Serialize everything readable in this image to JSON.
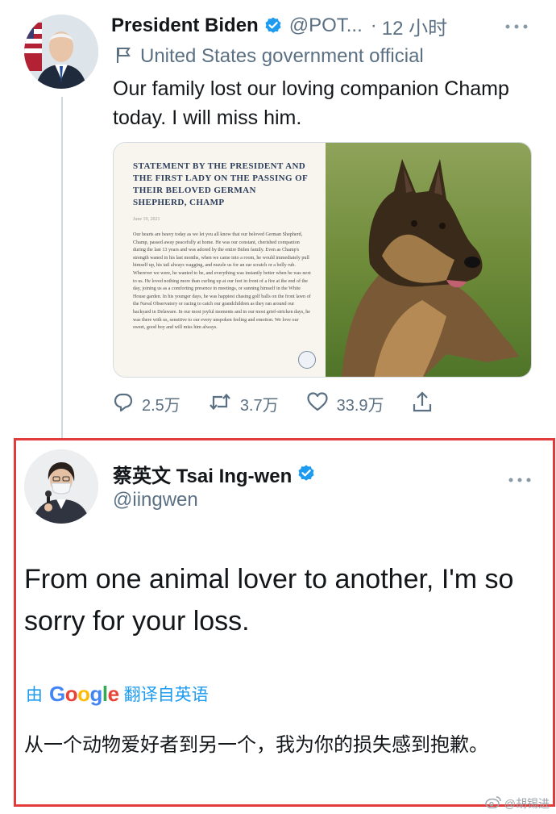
{
  "tweet1": {
    "name": "President Biden",
    "handle": "@POT...",
    "dot": "·",
    "time": "12 小时",
    "label": "United States government official",
    "body": "Our family lost our loving companion Champ today. I will miss him.",
    "card": {
      "title": "Statement by the President and the First Lady on the Passing of their Beloved German Shepherd, Champ",
      "date": "June 19, 2021",
      "body": "Our hearts are heavy today as we let you all know that our beloved German Shepherd, Champ, passed away peacefully at home. He was our constant, cherished companion during the last 13 years and was adored by the entire Biden family. Even as Champ's strength waned in his last months, when we came into a room, he would immediately pull himself up, his tail always wagging, and nuzzle us for an ear scratch or a belly rub. Wherever we were, he wanted to be, and everything was instantly better when he was next to us. He loved nothing more than curling up at our feet in front of a fire at the end of the day, joining us as a comforting presence in meetings, or sunning himself in the White House garden. In his younger days, he was happiest chasing golf balls on the front lawn of the Naval Observatory or racing to catch our grandchildren as they ran around our backyard in Delaware. In our most joyful moments and in our most grief-stricken days, he was there with us, sensitive to our every unspoken feeling and emotion. We love our sweet, good boy and will miss him always."
    },
    "actions": {
      "reply_count": "2.5万",
      "retweet_count": "3.7万",
      "like_count": "33.9万"
    }
  },
  "tweet2": {
    "name": "蔡英文 Tsai Ing-wen",
    "handle": "@iingwen",
    "body": "From one animal lover to another, I'm so sorry for your loss.",
    "translate_by": "由",
    "translate_brand": [
      "G",
      "o",
      "o",
      "g",
      "l",
      "e"
    ],
    "translate_from": "翻译自英语",
    "translation": "从一个动物爱好者到另一个，我为你的损失感到抱歉。"
  },
  "watermark": "@胡锡进",
  "colors": {
    "highlight_border": "#e33b3b",
    "link_blue": "#1d9bf0",
    "verified_blue": "#1d9bf0",
    "muted": "#5b7083"
  },
  "icons": [
    "verified-badge-icon",
    "flag-icon",
    "more-icon",
    "reply-icon",
    "retweet-icon",
    "like-icon",
    "share-icon",
    "weibo-icon"
  ]
}
